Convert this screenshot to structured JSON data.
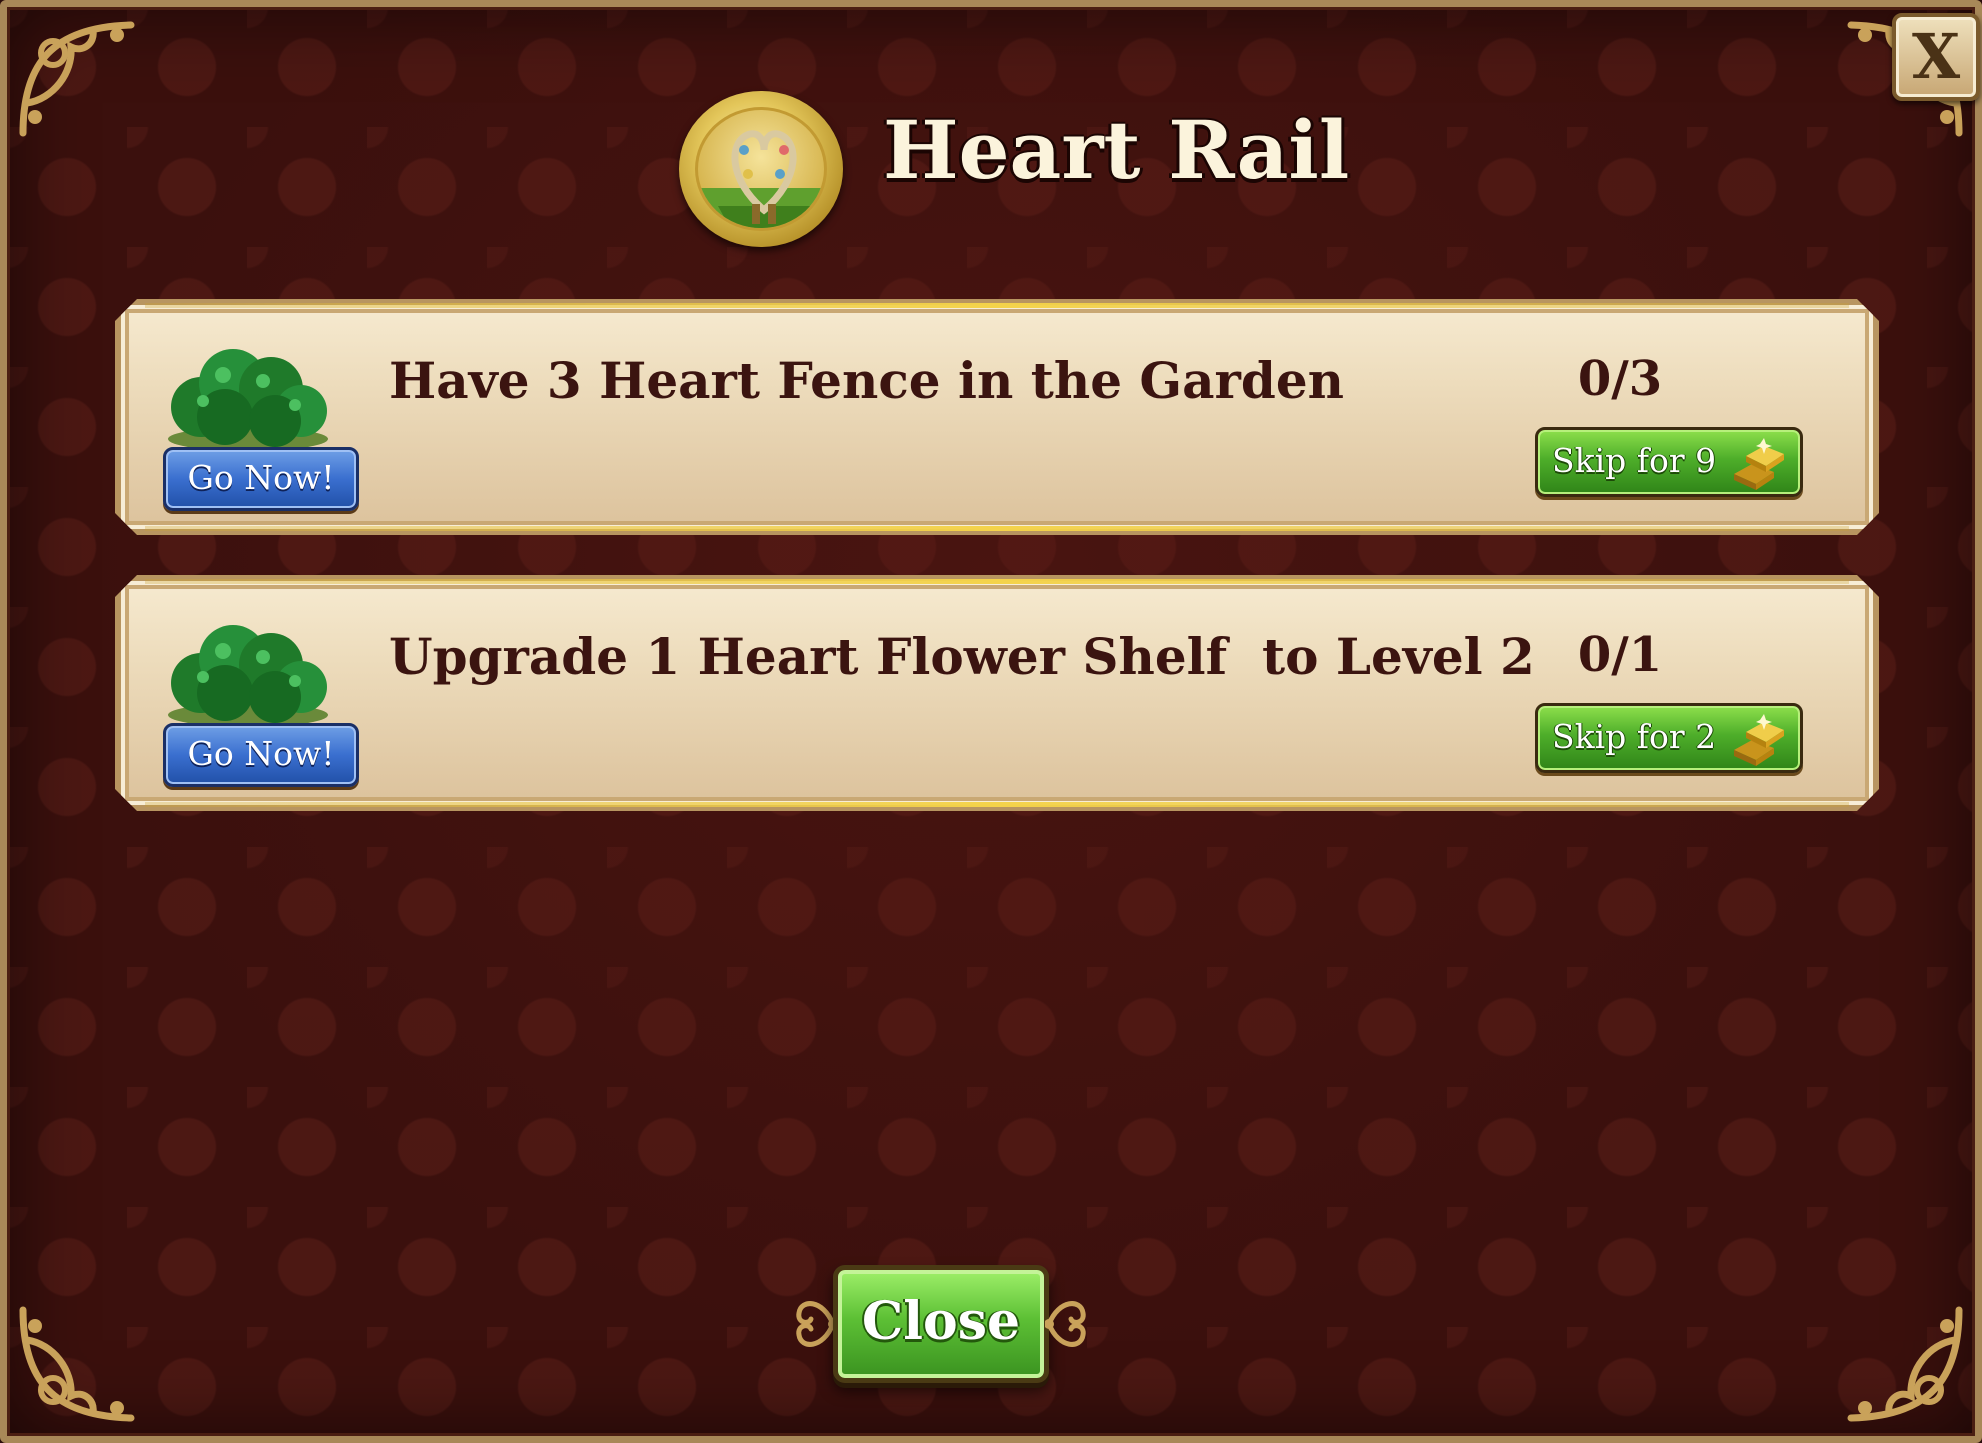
{
  "dialog": {
    "title": "Heart Rail",
    "close_x_label": "X",
    "close_button_label": "Close"
  },
  "tasks": [
    {
      "description": "Have 3 Heart Fence in the Garden",
      "progress": "0/3",
      "go_label": "Go Now!",
      "skip_label": "Skip for 9"
    },
    {
      "description": "Upgrade 1 Heart Flower Shelf  to Level 2",
      "progress": "0/1",
      "go_label": "Go Now!",
      "skip_label": "Skip for 2"
    }
  ],
  "icons": {
    "medal": "heart-rail-medal-icon",
    "task_thumb": "hedge-icon",
    "currency": "gold-bars-icon"
  },
  "colors": {
    "background": "#3b100d",
    "card": "#eddcbc",
    "go_button": "#3a6fcf",
    "skip_button": "#4eae2a",
    "close_button": "#5dc035",
    "title_text": "#fbf3dc",
    "task_text": "#3b1410"
  }
}
